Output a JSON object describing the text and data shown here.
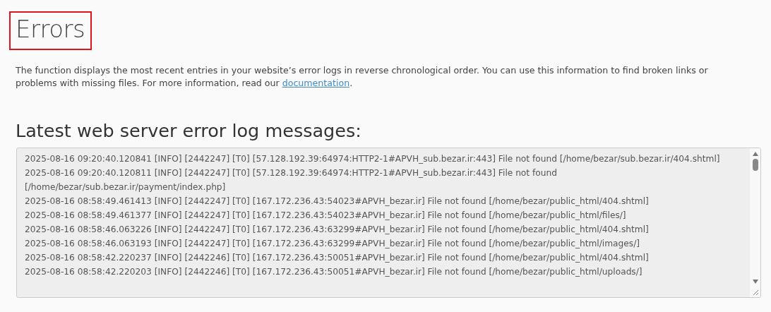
{
  "page_title": "Errors",
  "description": {
    "text": "The function displays the most recent entries in your website’s error logs in reverse chronological order. You can use this information to find broken links or problems with missing files. For more information, read our",
    "link": "documentation",
    "end": "."
  },
  "log_heading": "Latest web server error log messages:",
  "log_entries": [
    "2025-08-16 09:20:40.120841 [INFO] [2442247] [T0] [57.128.192.39:64974:HTTP2-1#APVH_sub.bezar.ir:443] File not found [/home/bezar/sub.bezar.ir/404.shtml]",
    "2025-08-16 09:20:40.120811 [INFO] [2442247] [T0] [57.128.192.39:64974:HTTP2-1#APVH_sub.bezar.ir:443] File not found [/home/bezar/sub.bezar.ir/payment/index.php]",
    "2025-08-16 08:58:49.461413 [INFO] [2442247] [T0] [167.172.236.43:54023#APVH_bezar.ir] File not found [/home/bezar/public_html/404.shtml]",
    "2025-08-16 08:58:49.461377 [INFO] [2442247] [T0] [167.172.236.43:54023#APVH_bezar.ir] File not found [/home/bezar/public_html/files/]",
    "2025-08-16 08:58:46.063226 [INFO] [2442247] [T0] [167.172.236.43:63299#APVH_bezar.ir] File not found [/home/bezar/public_html/404.shtml]",
    "2025-08-16 08:58:46.063193 [INFO] [2442247] [T0] [167.172.236.43:63299#APVH_bezar.ir] File not found [/home/bezar/public_html/images/]",
    "2025-08-16 08:58:42.220237 [INFO] [2442246] [T0] [167.172.236.43:50051#APVH_bezar.ir] File not found [/home/bezar/public_html/404.shtml]",
    "2025-08-16 08:58:42.220203 [INFO] [2442246] [T0] [167.172.236.43:50051#APVH_bezar.ir] File not found [/home/bezar/public_html/uploads/]"
  ]
}
